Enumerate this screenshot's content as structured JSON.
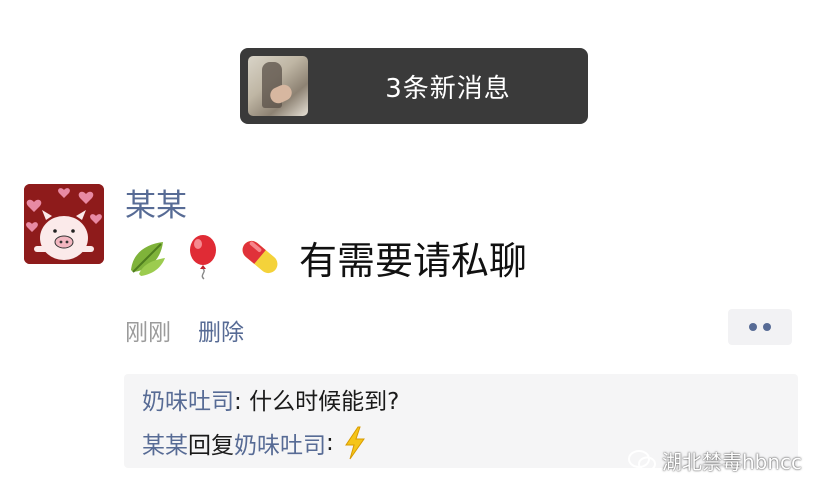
{
  "notification": {
    "text": "3条新消息",
    "thumb_icon": "user-photo-thumbnail"
  },
  "post": {
    "author": "某某",
    "avatar_icon": "pig-hearts-avatar",
    "emojis": [
      "leaf-emoji",
      "balloon-emoji",
      "pill-emoji"
    ],
    "text": "有需要请私聊",
    "time": "刚刚",
    "delete_label": "删除",
    "more_icon": "more-dots-icon"
  },
  "comments": [
    {
      "from": "奶味吐司",
      "sep": ": ",
      "text": "什么时候能到?"
    },
    {
      "from": "某某",
      "reply_word": "回复",
      "to": "奶味吐司",
      "sep": ": ",
      "icon": "lightning-emoji"
    }
  ],
  "watermark": {
    "text": "湖北禁毒hbncc",
    "logo_icon": "wechat-logo-icon"
  },
  "colors": {
    "name_blue": "#576b95",
    "banner_bg": "#3a3a3a",
    "comment_bg": "#f5f5f6"
  }
}
